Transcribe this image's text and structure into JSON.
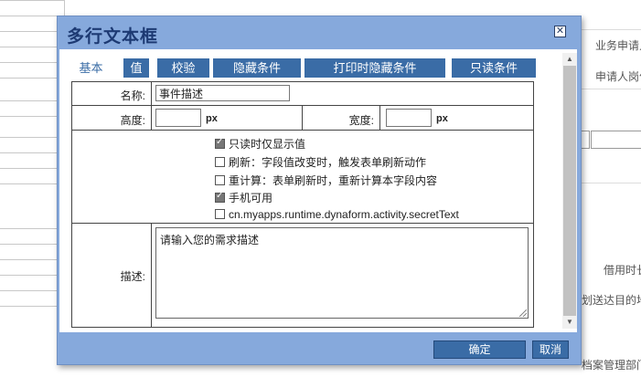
{
  "background": {
    "right_labels": [
      "业务申请人",
      "申请人岗位",
      "借用时长",
      "划送达目的地",
      "档案管理部门"
    ]
  },
  "dialog": {
    "title": "多行文本框",
    "close_glyph": "✕",
    "tabs": [
      {
        "label": "基本",
        "active": true
      },
      {
        "label": "值",
        "active": false
      },
      {
        "label": "校验",
        "active": false
      },
      {
        "label": "隐藏条件",
        "active": false
      },
      {
        "label": "打印时隐藏条件",
        "active": false
      },
      {
        "label": "只读条件",
        "active": false
      }
    ],
    "fields": {
      "name_label": "名称:",
      "name_value": "事件描述",
      "height_label": "高度:",
      "height_value": "",
      "height_unit": "px",
      "width_label": "宽度:",
      "width_value": "",
      "width_unit": "px",
      "desc_label": "描述:",
      "desc_placeholder": "请输入您的需求描述"
    },
    "options": [
      {
        "label": "只读时仅显示值",
        "checked": true
      },
      {
        "label": "刷新：字段值改变时，触发表单刷新动作",
        "checked": false
      },
      {
        "label": "重计算：表单刷新时，重新计算本字段内容",
        "checked": false
      },
      {
        "label": "手机可用",
        "checked": true
      },
      {
        "label": "cn.myapps.runtime.dynaform.activity.secretText",
        "checked": false
      }
    ],
    "buttons": {
      "ok": "确定",
      "cancel": "取消"
    },
    "icons": {
      "scroll_up": "scroll-up-icon",
      "scroll_down": "scroll-down-icon"
    },
    "colors": {
      "frame": "#86a9dc",
      "tab": "#3a6ca6",
      "title": "#1d3a73"
    }
  }
}
